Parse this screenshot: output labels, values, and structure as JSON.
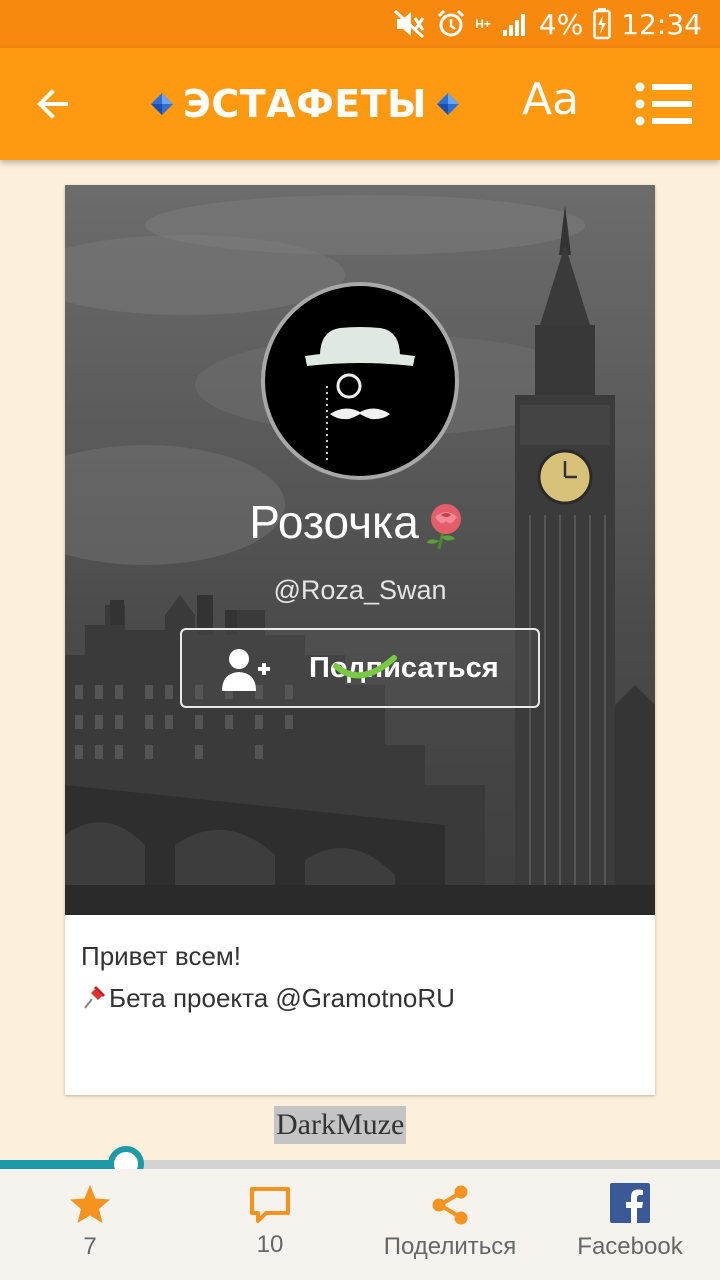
{
  "status_bar": {
    "battery": "4%",
    "time": "12:34",
    "network": "H+",
    "icons": [
      "mute-icon",
      "alarm-icon",
      "network-icon",
      "signal-icon",
      "battery-charging-icon"
    ]
  },
  "app_bar": {
    "title": "ЭСТАФЕТЫ",
    "font_button": "Aa",
    "icons": [
      "back-arrow-icon",
      "blue-diamond-icon",
      "menu-list-icon"
    ]
  },
  "profile": {
    "name": "Розочка",
    "handle": "@Roza_Swan",
    "subscribe_label": "Подписаться",
    "bio_lines": [
      "Привет всем!",
      "Бета проекта @GramotnoRU"
    ],
    "icons": [
      "gentleman-avatar",
      "rose-icon",
      "add-user-icon",
      "loading-spinner-icon",
      "pushpin-icon"
    ]
  },
  "author": "DarkMuze",
  "reading_progress": 0.175,
  "bottom_bar": {
    "likes": "7",
    "comments": "10",
    "share_label": "Поделиться",
    "facebook_label": "Facebook",
    "icons": [
      "star-icon",
      "comment-icon",
      "share-icon",
      "facebook-icon"
    ]
  },
  "colors": {
    "status_bar": "#f6890e",
    "app_bar": "#fd9a12",
    "page_bg": "#fcefdc",
    "accent_teal": "#1e9aa7",
    "star": "#f6921e"
  }
}
